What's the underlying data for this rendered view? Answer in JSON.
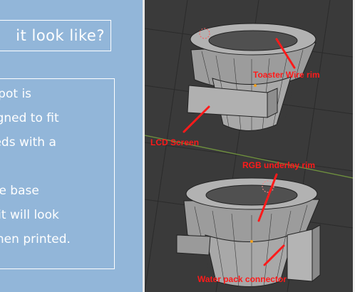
{
  "left_panel": {
    "heading": "it look like?",
    "lines": [
      "n pot is",
      "signed to fit",
      "eeds with a",
      "(:",
      "the base",
      "h it will look",
      "when printed."
    ]
  },
  "viewport": {
    "callouts": {
      "toaster_wire_rim": "Toaster Wire rim",
      "lcd_screen": "LCD Screen",
      "rgb_underlay_rim": "RGB underlay rim",
      "water_pack_connector": "Water pack connector"
    },
    "colors": {
      "background": "#3a3a3a",
      "callout": "#ff1a1a",
      "model": "#a6a6a6"
    }
  }
}
